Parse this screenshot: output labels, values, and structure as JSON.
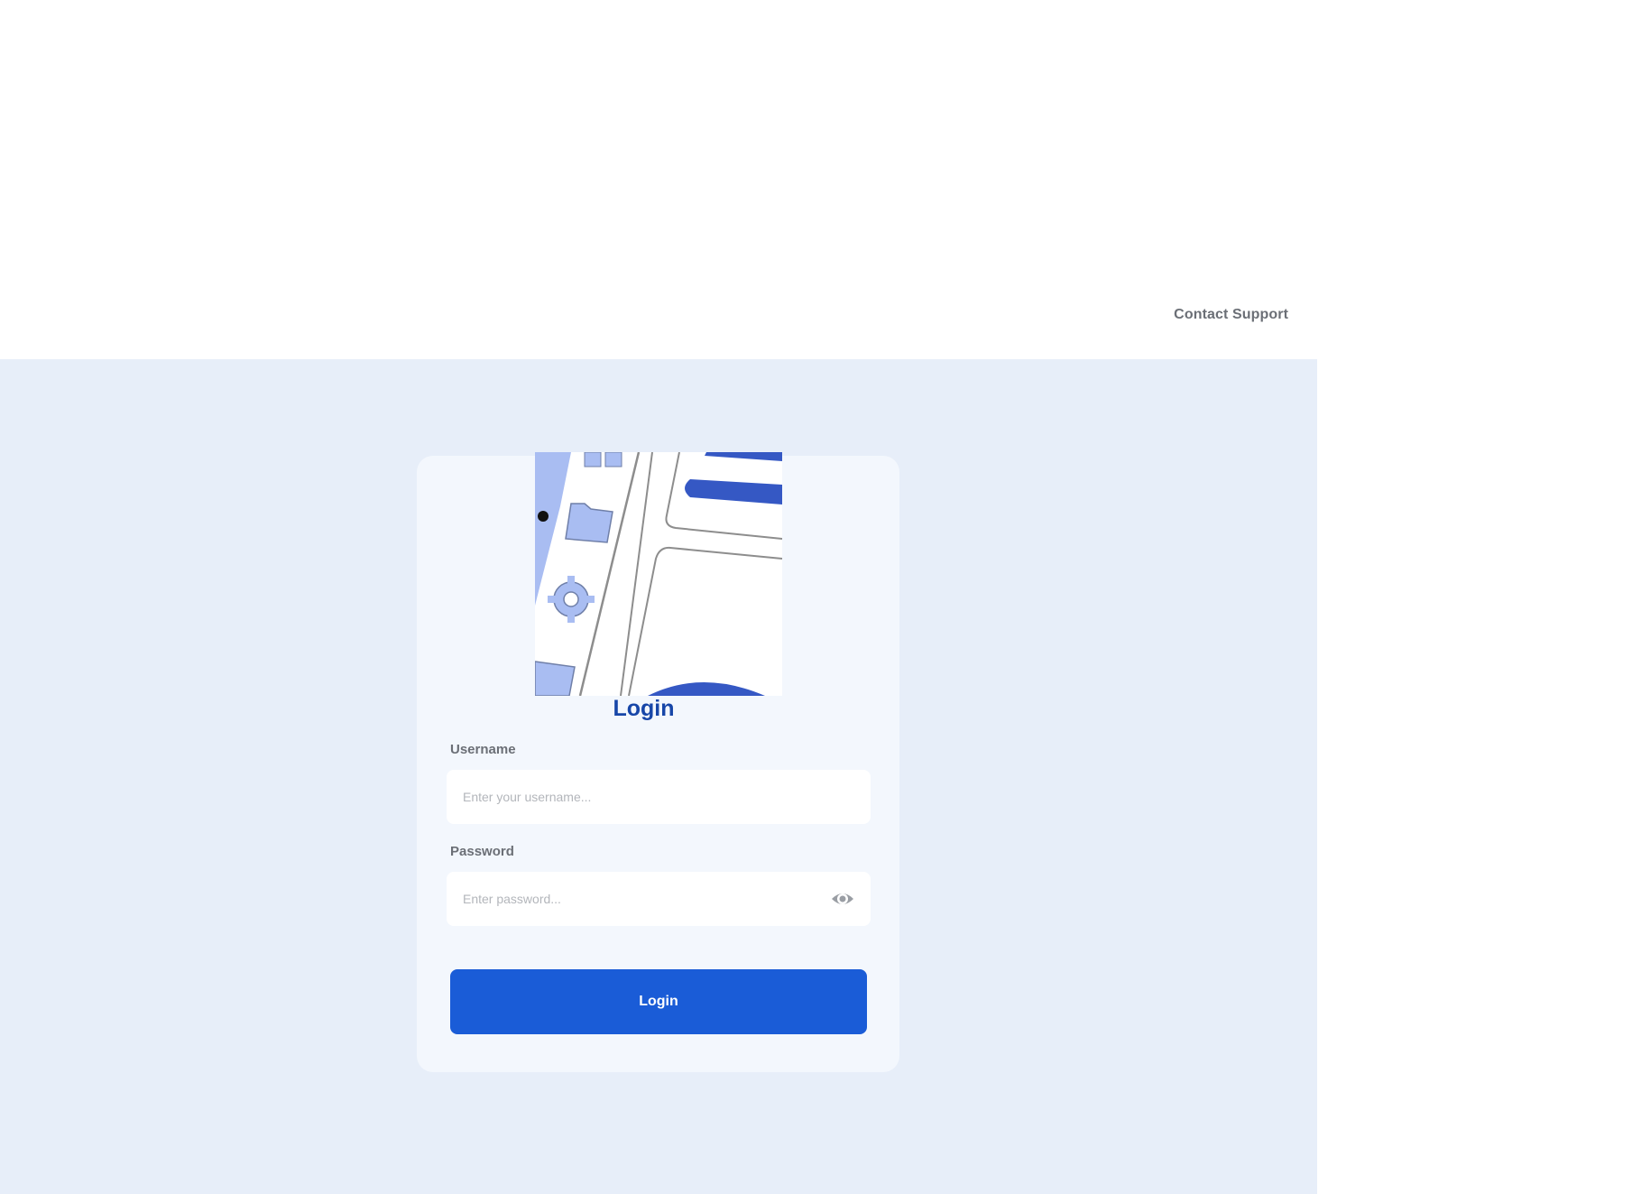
{
  "header": {
    "contact_label": "Contact Support"
  },
  "login_card": {
    "logo_icon": "map-icon",
    "title": "Login",
    "username_label": "Username",
    "username_placeholder": "Enter your username...",
    "password_label": "Password",
    "password_placeholder": "Enter password...",
    "eye_icon": "eye-icon",
    "submit_label": "Login"
  },
  "colors": {
    "page_bg": "#e7eef9",
    "card_bg": "#f3f7fd",
    "accent": "#1a5cd7",
    "title": "#1746a8",
    "muted_text": "#6b6f76"
  }
}
